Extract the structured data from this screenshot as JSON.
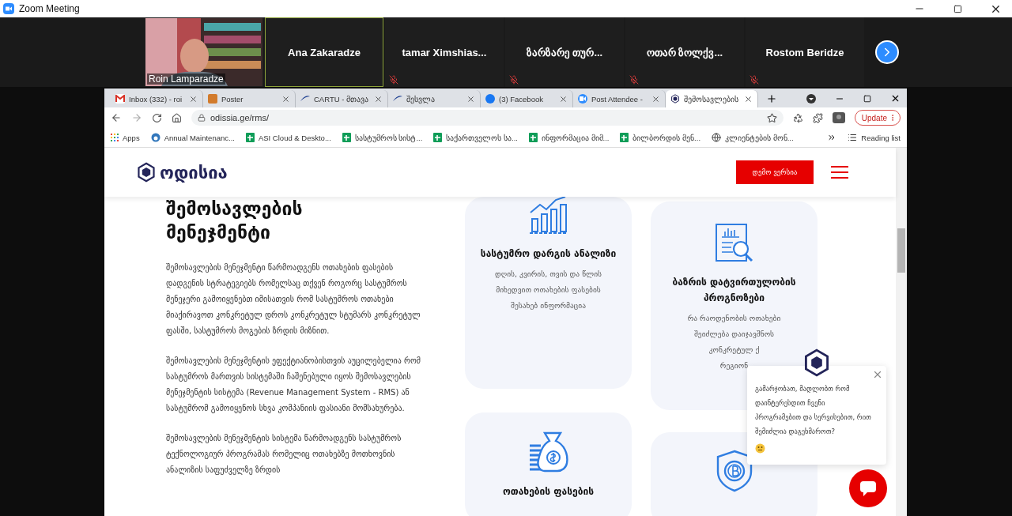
{
  "window": {
    "title": "Zoom Meeting"
  },
  "participants": [
    {
      "name": "Roin Lamparadze",
      "kind": "video",
      "speaking": false,
      "muted": false
    },
    {
      "name": "Ana Zakaradze",
      "kind": "name",
      "speaking": true,
      "muted": false
    },
    {
      "name": "tamar  Ximshias...",
      "kind": "name",
      "speaking": false,
      "muted": true
    },
    {
      "name": "ზარზარე თურ...",
      "kind": "name",
      "speaking": false,
      "muted": true
    },
    {
      "name": "ოთარ ზოლქვ...",
      "kind": "name",
      "speaking": false,
      "muted": true
    },
    {
      "name": "Rostom Beridze",
      "kind": "name",
      "speaking": false,
      "muted": true
    }
  ],
  "browser": {
    "tabs": [
      {
        "title": "Inbox (332) - roi",
        "selected": false
      },
      {
        "title": "Poster",
        "selected": false
      },
      {
        "title": "CARTU - მთავა",
        "selected": false
      },
      {
        "title": "შესვლა",
        "selected": false
      },
      {
        "title": "(3) Facebook",
        "selected": false
      },
      {
        "title": "Post Attendee - ",
        "selected": false
      },
      {
        "title": "შემოსავლების",
        "selected": true
      }
    ],
    "url": "odissia.ge/rms/",
    "update_button": "Update",
    "bookmarks": [
      "Apps",
      "Annual Maintenanc...",
      "ASI Cloud & Deskto...",
      "სასტუმროს სისტ...",
      "საქართველოს სა...",
      "ინფორმაცია მიმ...",
      "ბილბორდის მენ...",
      "კლიენტების მონ..."
    ],
    "reading_list": "Reading list"
  },
  "page": {
    "logo": "ოდისია",
    "demo_button": "დემო ვერსია",
    "heading": "შემოსავლების მენეჯმენტი",
    "paragraphs": [
      "შემოსავლების მენეჯმენტი წარმოადგენს ოთახების ფასების დადგენის სტრატეგიებს რომელსაც თქვენ როგორც სასტუმროს მენეჯერი გამოიყენებთ იმისათვის რომ სასტუმროს ოთახები მიაქირავოთ კონკრეტულ დროს კონკრეტულ სტუმარს კონკრეტულ ფასში, სასტუმროს მოგების ზრდის მიზნით.",
      "შემოსავლების მენეჯმენტის ეფექტიანობისთვის აუცილებელია რომ სასტუმროს მართვის სისტემაში ჩაშენებული იყოს შემოსავლების მენეჯმენტის სისტემა (Revenue Management System - RMS) ან სასტუმრომ გამოიყენოს სხვა კომპანიის ფასიანი მომსახურება.",
      "შემოსავლების მენეჯმენტის სისტემა წარმოადგენს სასტუმროს ტექნოლოგიურ პროგრამას რომელიც ოთახებზე მოთხოვნის ანალიზის საფუძველზე ზრდის"
    ],
    "cards": [
      {
        "kind": "chart",
        "title": "სასტუმრო დარგის ანალიზი",
        "description": [
          "დღის, კვირის, თვის და წლის",
          "მიხედვით ოთახების ფასების",
          "შესახებ ინფორმაცია"
        ]
      },
      {
        "kind": "report",
        "title": "ბაზრის დატვირთულობის პროგნოზები",
        "description": [
          "რა რაოდენობის ოთახები",
          "შეიძლება დაიჯავშნოს",
          "კონკრეტულ ქ",
          "რეგიონ"
        ]
      },
      {
        "kind": "moneybag",
        "title": "ოთახების ფასების"
      },
      {
        "kind": "shield"
      }
    ],
    "chat": {
      "message": "გამარჯობათ, მადლობთ რომ დაინტერესდით ჩვენი პროგრამებით და სერვისებით, რით შემიძლია დაგეხმაროთ?"
    }
  }
}
